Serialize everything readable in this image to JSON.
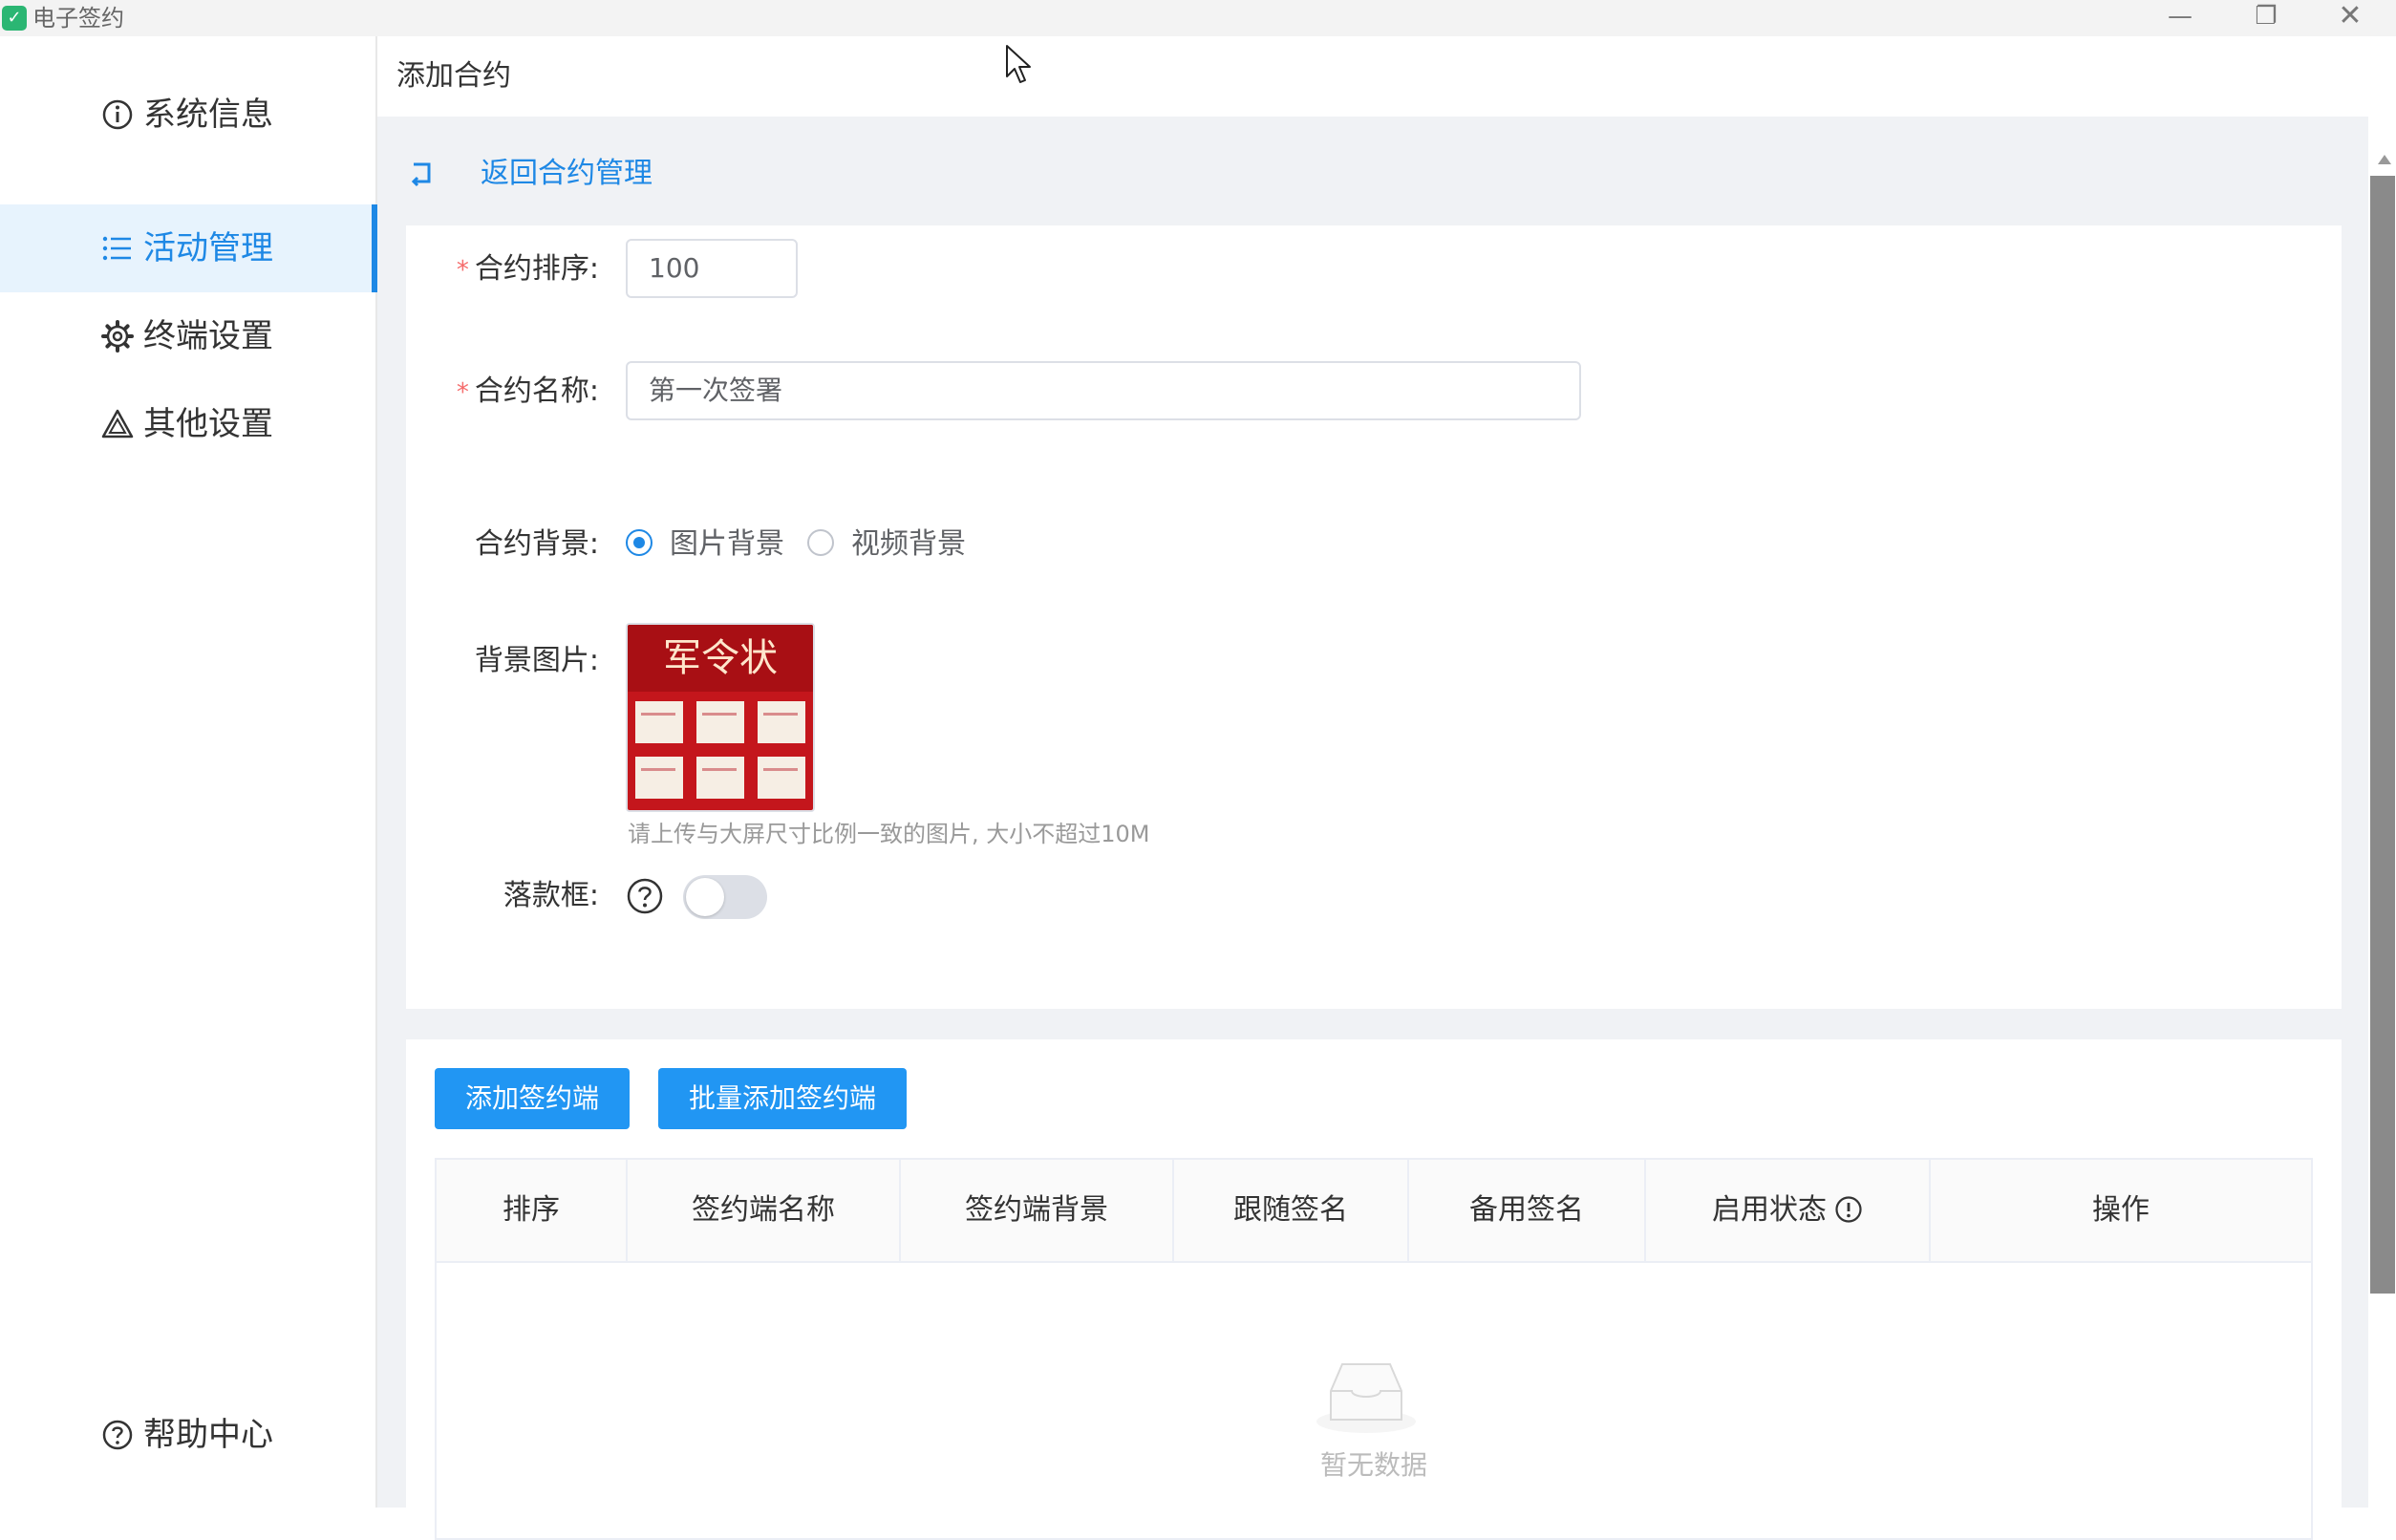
{
  "window": {
    "title": "电子签约",
    "app_icon_glyph": "✓",
    "controls": {
      "minimize": "—",
      "maximize": "❐",
      "close": "✕"
    }
  },
  "sidebar": {
    "items": [
      {
        "label": "系统信息",
        "icon": "info-circle-icon",
        "active": false
      },
      {
        "label": "活动管理",
        "icon": "list-icon",
        "active": true
      },
      {
        "label": "终端设置",
        "icon": "gear-icon",
        "active": false
      },
      {
        "label": "其他设置",
        "icon": "warning-triangle-icon",
        "active": false
      }
    ],
    "help": {
      "label": "帮助中心",
      "icon": "question-circle-icon"
    }
  },
  "header": {
    "title": "添加合约"
  },
  "back_link": {
    "label": "返回合约管理",
    "icon": "return-icon"
  },
  "form": {
    "order": {
      "label": "合约排序:",
      "required": true,
      "value": "100"
    },
    "name": {
      "label": "合约名称:",
      "required": true,
      "value": "第一次签署"
    },
    "background": {
      "label": "合约背景:",
      "options": [
        {
          "label": "图片背景",
          "checked": true
        },
        {
          "label": "视频背景",
          "checked": false
        }
      ]
    },
    "background_image": {
      "label": "背景图片:",
      "hint": "请上传与大屏尺寸比例一致的图片, 大小不超过10M",
      "thumbnail_text": "军令状"
    },
    "signature_box": {
      "label": "落款框:",
      "enabled": false
    }
  },
  "actions": {
    "add_button": "添加签约端",
    "batch_add_button": "批量添加签约端"
  },
  "table": {
    "columns": [
      "排序",
      "签约端名称",
      "签约端背景",
      "跟随签名",
      "备用签名",
      "启用状态",
      "操作"
    ],
    "rows": [],
    "empty_text": "暂无数据"
  },
  "colors": {
    "accent": "#1e88e5",
    "button": "#2196f3",
    "required": "#f56c6c",
    "active_bg": "#e7f3fd",
    "page_bg": "#f0f2f5"
  }
}
